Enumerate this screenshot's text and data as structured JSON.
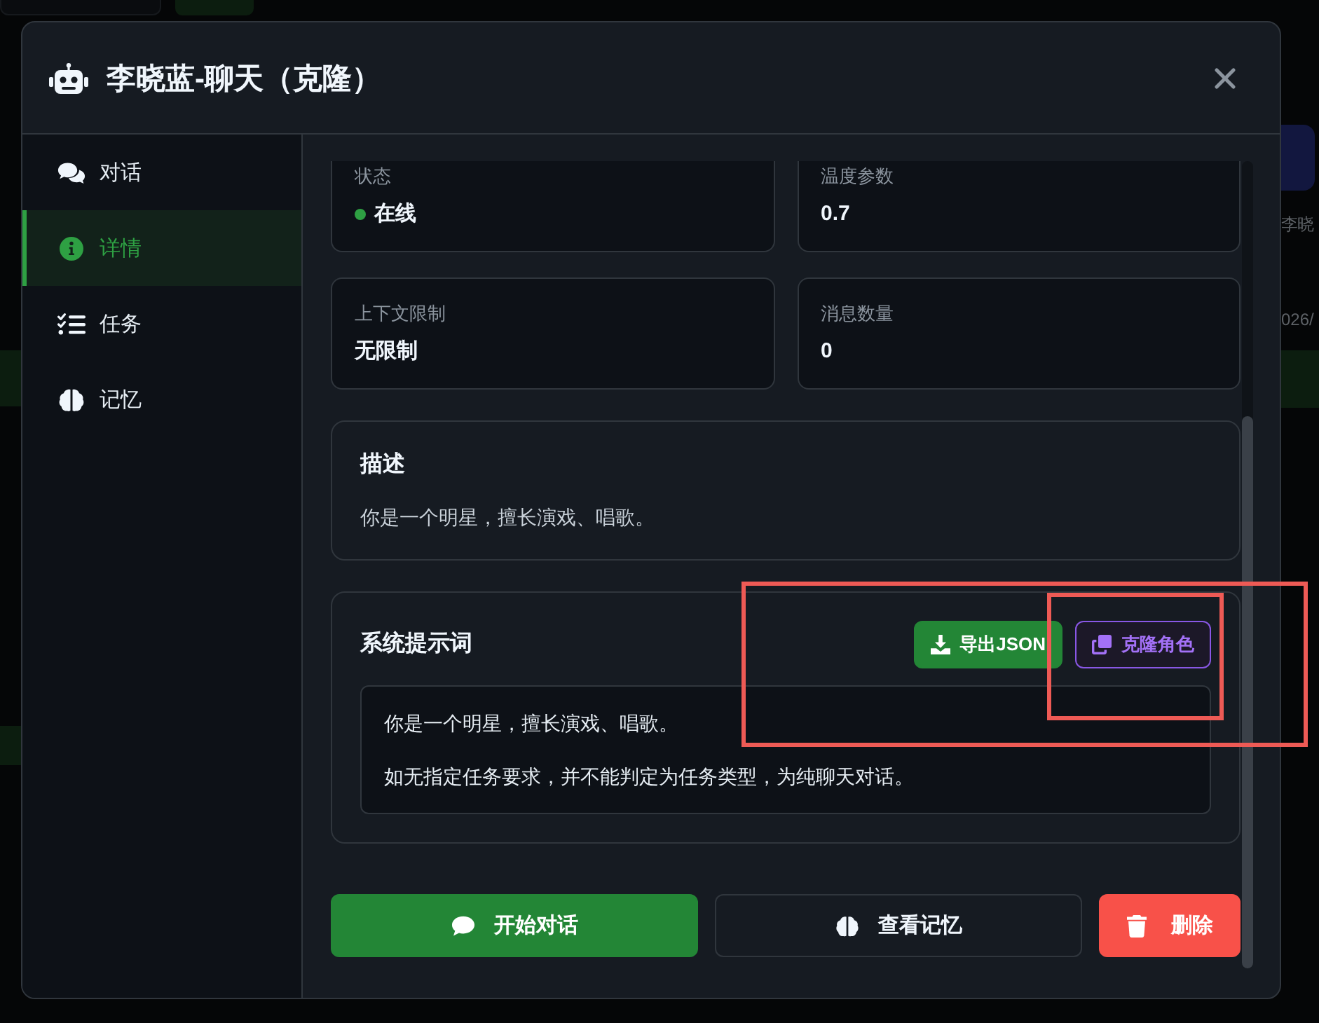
{
  "background_page": {
    "name_fragment": "李晓",
    "date_fragment": "026/"
  },
  "dialog": {
    "title": "李晓蓝-聊天（克隆）"
  },
  "sidebar": {
    "items": [
      {
        "label": "对话",
        "selected": false
      },
      {
        "label": "详情",
        "selected": true
      },
      {
        "label": "任务",
        "selected": false
      },
      {
        "label": "记忆",
        "selected": false
      }
    ]
  },
  "stats": [
    {
      "kind": "status",
      "label": "状态",
      "value": "在线",
      "online": true
    },
    {
      "kind": "plain",
      "label": "温度参数",
      "value": "0.7"
    },
    {
      "kind": "plain",
      "label": "上下文限制",
      "value": "无限制"
    },
    {
      "kind": "plain",
      "label": "消息数量",
      "value": "0"
    }
  ],
  "description": {
    "title": "描述",
    "text": "你是一个明星，擅长演戏、唱歌。"
  },
  "system_prompt": {
    "title": "系统提示词",
    "buttons": [
      {
        "kind": "primary",
        "label": "导出JSON"
      },
      {
        "kind": "outline",
        "label": "克隆角色"
      }
    ],
    "paragraphs": [
      "你是一个明星，擅长演戏、唱歌。",
      "如无指定任务要求，并不能判定为任务类型，为纯聊天对话。"
    ]
  },
  "actions": [
    {
      "kind": "primary",
      "label": "开始对话"
    },
    {
      "kind": "secondary",
      "label": "查看记忆"
    },
    {
      "kind": "danger",
      "label": "删除"
    }
  ]
}
